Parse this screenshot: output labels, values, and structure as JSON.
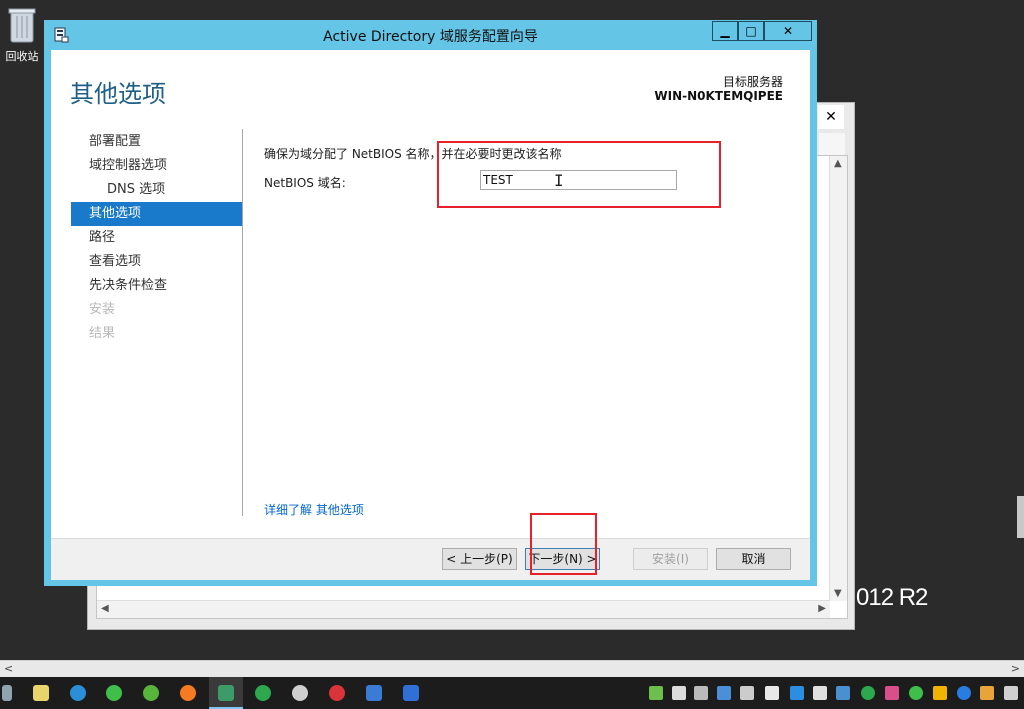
{
  "desktop": {
    "recycle_bin_label": "回收站",
    "background_brand_text": "012 R2"
  },
  "wizard": {
    "title": "Active Directory 域服务配置向导",
    "window_buttons": {
      "minimize": "▁",
      "maximize": "□",
      "close": "✕"
    },
    "page_title": "其他选项",
    "target_server_label": "目标服务器",
    "target_server_name": "WIN-N0KTEMQIPEE",
    "nav": [
      {
        "label": "部署配置",
        "state": "normal"
      },
      {
        "label": "域控制器选项",
        "state": "normal"
      },
      {
        "label": "DNS 选项",
        "state": "sub"
      },
      {
        "label": "其他选项",
        "state": "active"
      },
      {
        "label": "路径",
        "state": "normal"
      },
      {
        "label": "查看选项",
        "state": "normal"
      },
      {
        "label": "先决条件检查",
        "state": "normal"
      },
      {
        "label": "安装",
        "state": "disabled"
      },
      {
        "label": "结果",
        "state": "disabled"
      }
    ],
    "description": "确保为域分配了 NetBIOS 名称，并在必要时更改该名称",
    "netbios_label": "NetBIOS 域名:",
    "netbios_value": "TEST",
    "learn_more": "详细了解 其他选项",
    "buttons": {
      "prev": "< 上一步(P)",
      "next": "下一步(N) >",
      "install": "安装(I)",
      "cancel": "取消"
    }
  },
  "background_window": {
    "close": "✕"
  },
  "taskbar": {
    "apps": [
      "file-manager-icon",
      "edge-icon",
      "wechat-icon",
      "clover-icon",
      "firefox-icon",
      "eye-app-icon",
      "green-circle-icon",
      "gear-icon",
      "red-app-icon",
      "photo-icon",
      "wps-icon"
    ],
    "tray": [
      "tray-app-icon",
      "tb-icon",
      "printer-icon",
      "package-icon",
      "volume-muted-icon",
      "shield-icon",
      "power-icon",
      "battery-icon",
      "monitor-icon",
      "green-app-icon",
      "color-icon",
      "wechat-tray-icon",
      "shield-yellow-icon",
      "bluetooth-icon",
      "app-tray-icon",
      "network-icon"
    ]
  },
  "colors": {
    "title_bar": "#64c5e6",
    "accent": "#1979ca",
    "page_title": "#1e5f88",
    "highlight": "#e8202a"
  }
}
